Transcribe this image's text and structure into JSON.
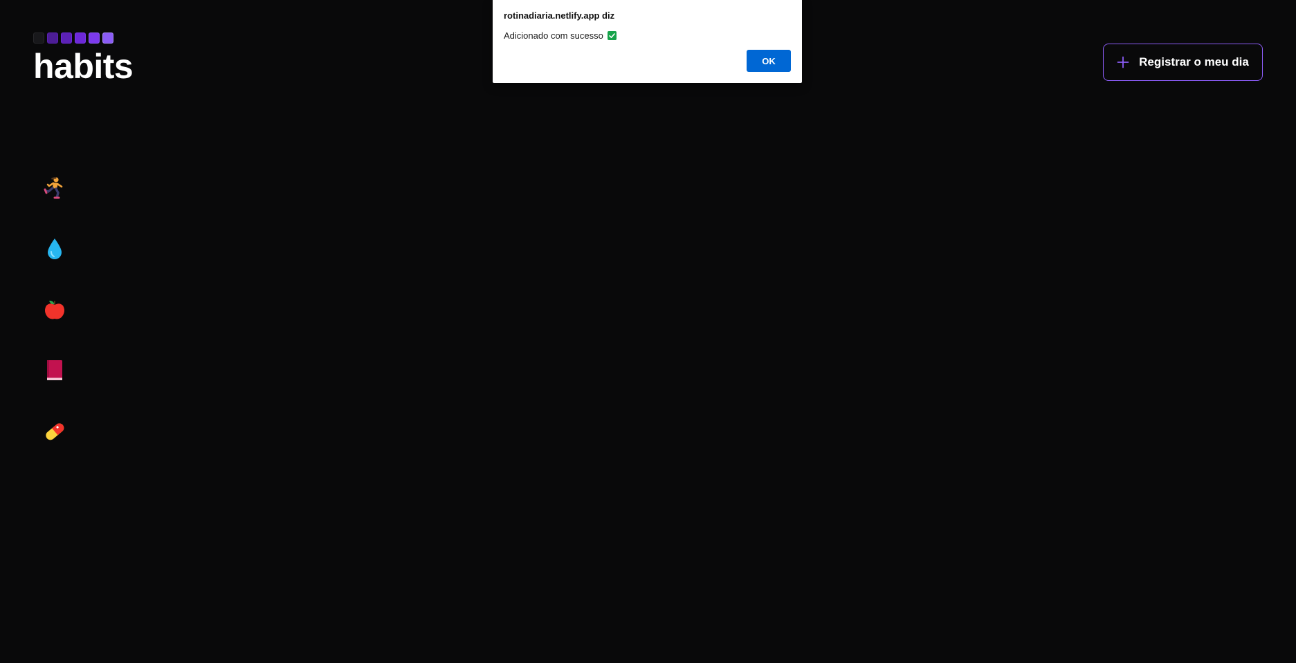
{
  "app": {
    "logo_text": "habits",
    "logo_square_count": 6
  },
  "header": {
    "register_label": "Registrar o meu dia",
    "register_icon": "plus-icon"
  },
  "habits": [
    {
      "icon": "runner-emoji"
    },
    {
      "icon": "droplet-emoji"
    },
    {
      "icon": "apple-emoji"
    },
    {
      "icon": "book-emoji"
    },
    {
      "icon": "pill-emoji"
    }
  ],
  "dialog": {
    "title": "rotinadiaria.netlify.app diz",
    "message": "Adicionado com sucesso",
    "message_icon": "check-box-icon",
    "ok_label": "OK"
  },
  "colors": {
    "background": "#09090a",
    "accent": "#8b5cf6",
    "ok_button": "#0067d4",
    "check_green": "#16a34a"
  }
}
